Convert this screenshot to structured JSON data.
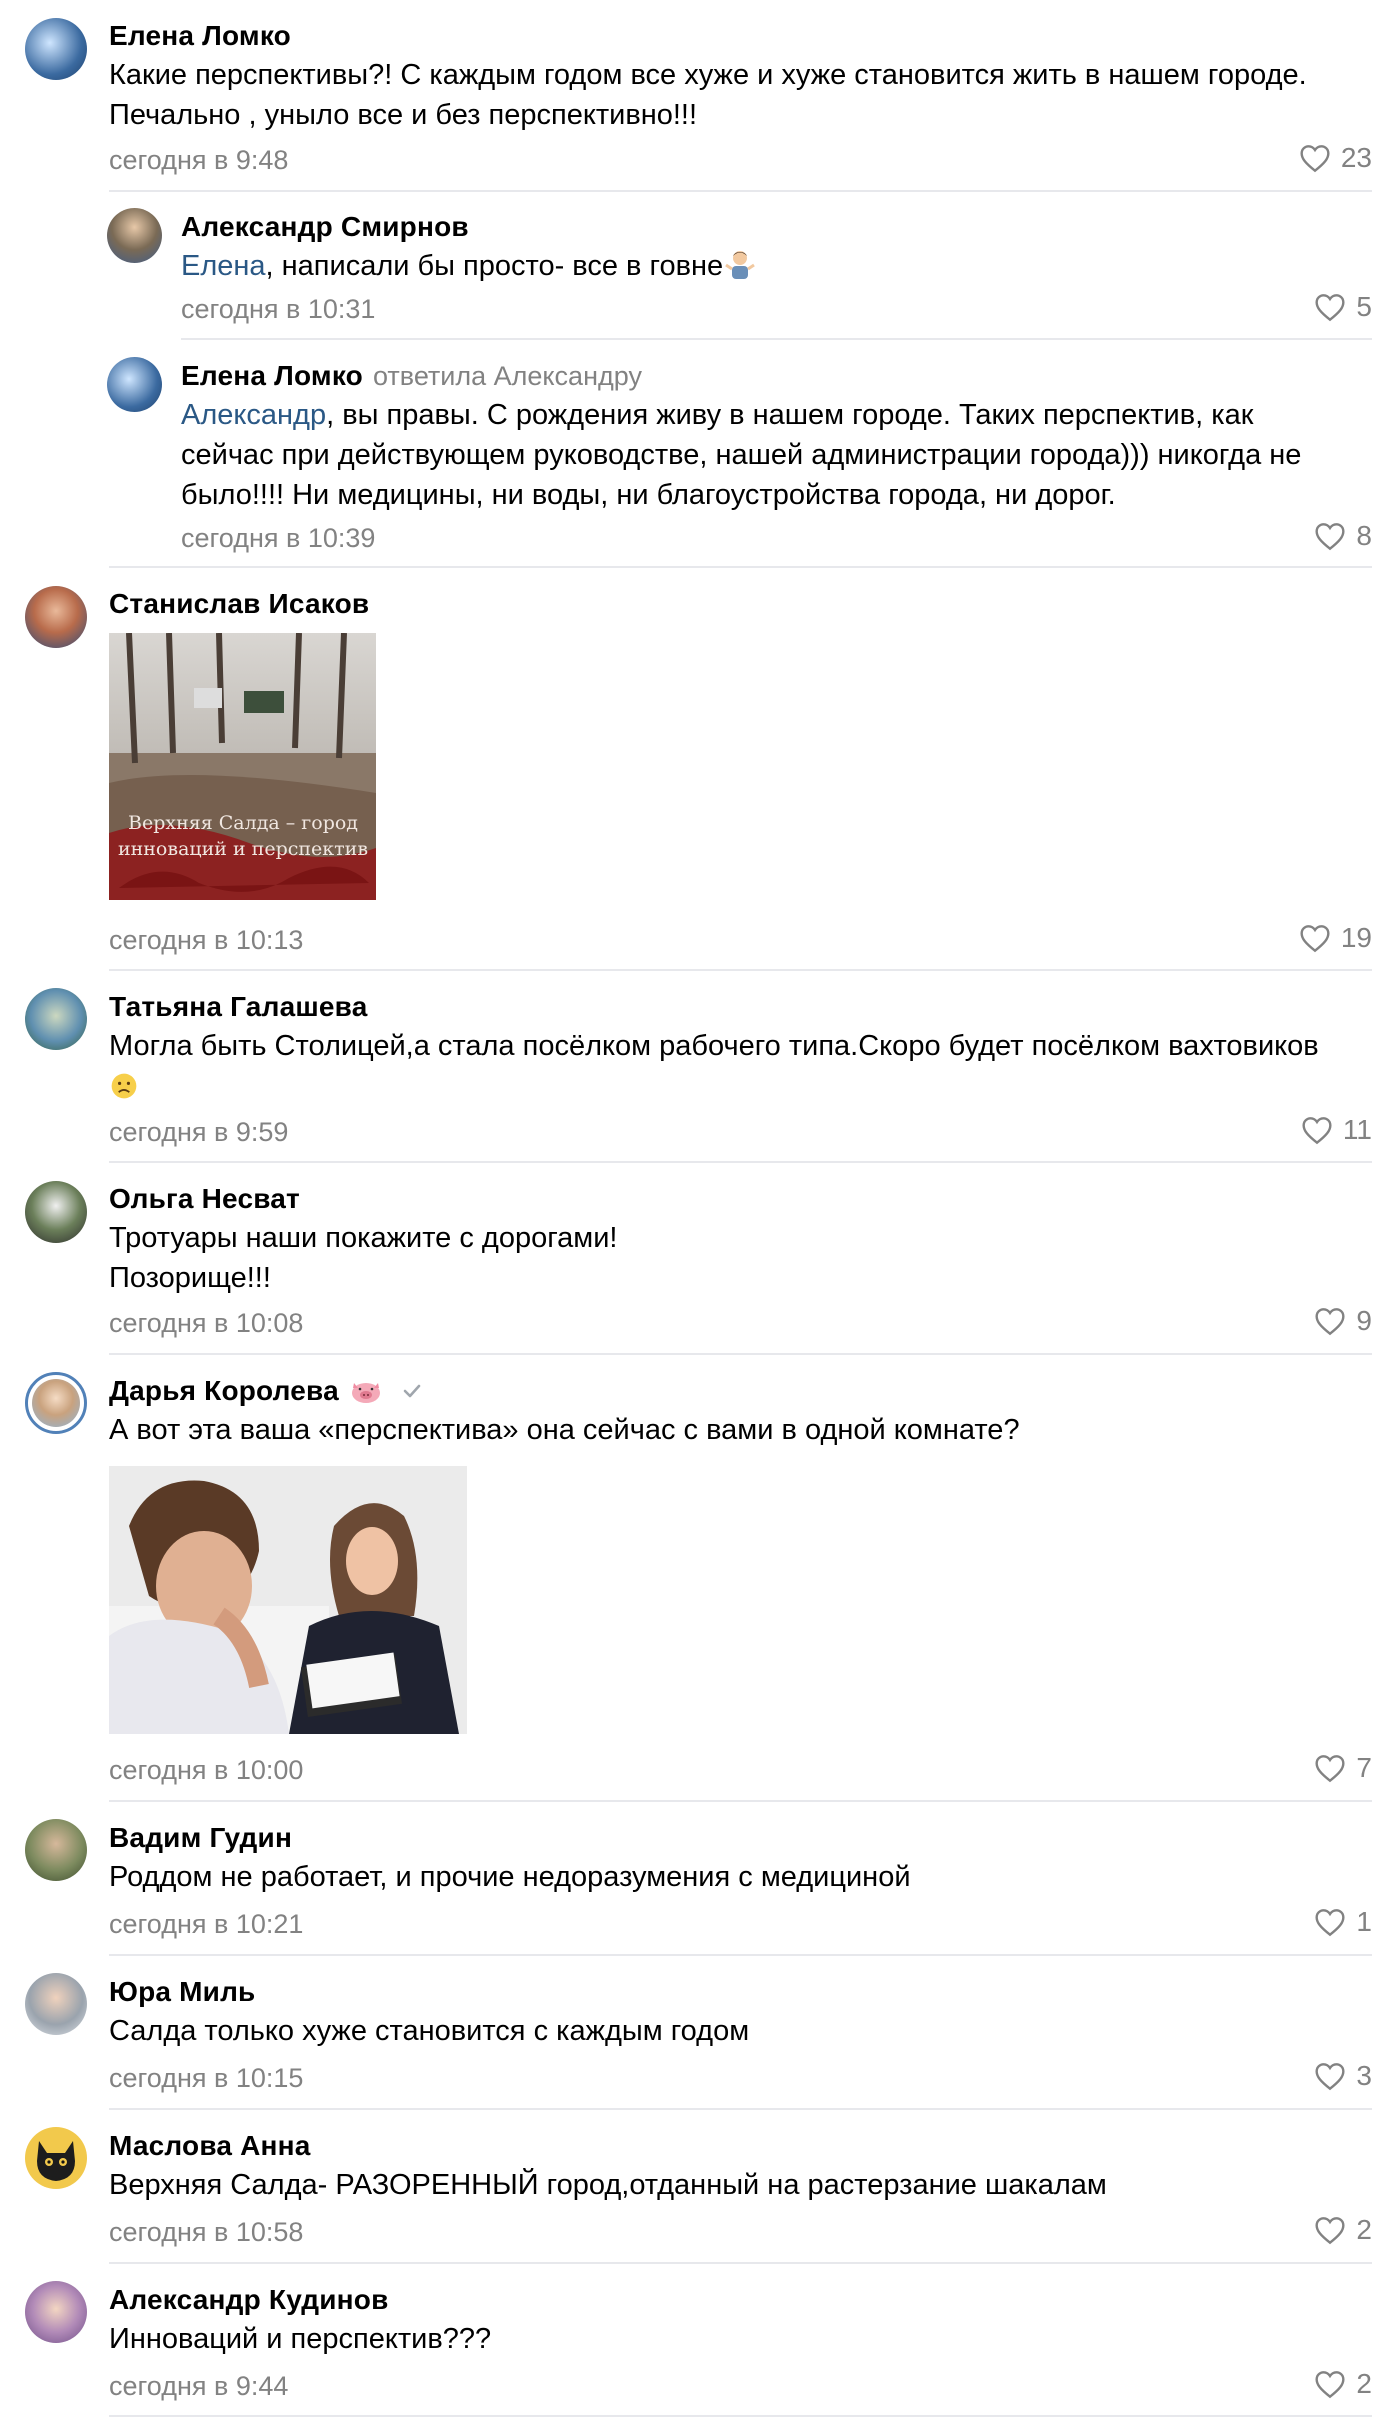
{
  "comments": [
    {
      "author": "Елена Ломко",
      "text": "Какие перспективы?! С каждым годом все хуже и хуже становится жить в нашем городе.\nПечально , уныло все и без перспективно!!!",
      "time": "сегодня в 9:48",
      "likes": "23"
    },
    {
      "author": "Александр Смирнов",
      "mention": "Елена",
      "text": ", написали бы просто- все в говне",
      "time": "сегодня в 10:31",
      "likes": "5"
    },
    {
      "author": "Елена Ломко",
      "replied_to": "ответила Александру",
      "mention": "Александр",
      "text": ", вы правы. С рождения живу в нашем городе. Таких перспектив, как\nсейчас при действующем руководстве, нашей администрации города))) никогда не\nбыло!!!! Ни медицины, ни воды, ни благоустройства города, ни дорог.",
      "time": "сегодня в 10:39",
      "likes": "8"
    },
    {
      "author": "Станислав Исаков",
      "image_caption": "Верхняя Салда – город\nинноваций и перспектив",
      "time": "сегодня в 10:13",
      "likes": "19"
    },
    {
      "author": "Татьяна Галашева",
      "text": "Могла быть Столицей,а стала посёлком рабочего типа.Скоро будет посёлком вахтовиков",
      "time": "сегодня в 9:59",
      "likes": "11"
    },
    {
      "author": "Ольга Несват",
      "text": "Тротуары наши покажите с дорогами!\nПозорище!!!",
      "time": "сегодня в 10:08",
      "likes": "9"
    },
    {
      "author": "Дарья Королева",
      "text": "А вот эта ваша «перспектива» она сейчас с вами в одной комнате?",
      "time": "сегодня в 10:00",
      "likes": "7"
    },
    {
      "author": "Вадим Гудин",
      "text": "Роддом не работает, и прочие недоразумения с медициной",
      "time": "сегодня в 10:21",
      "likes": "1"
    },
    {
      "author": "Юра Миль",
      "text": "Салда только хуже становится с каждым годом",
      "time": "сегодня в 10:15",
      "likes": "3"
    },
    {
      "author": "Маслова Анна",
      "text": "Верхняя Салда- РАЗОРЕННЫЙ город,отданный на растерзание шакалам",
      "time": "сегодня в 10:58",
      "likes": "2"
    },
    {
      "author": "Александр Кудинов",
      "text": "Инноваций и перспектив???",
      "time": "сегодня в 9:44",
      "likes": "2"
    }
  ],
  "icons": {
    "like": "heart-icon",
    "verified": "check-icon"
  },
  "colors": {
    "link": "#2a5885",
    "meta": "#828282",
    "divider": "#e7e8ec"
  }
}
